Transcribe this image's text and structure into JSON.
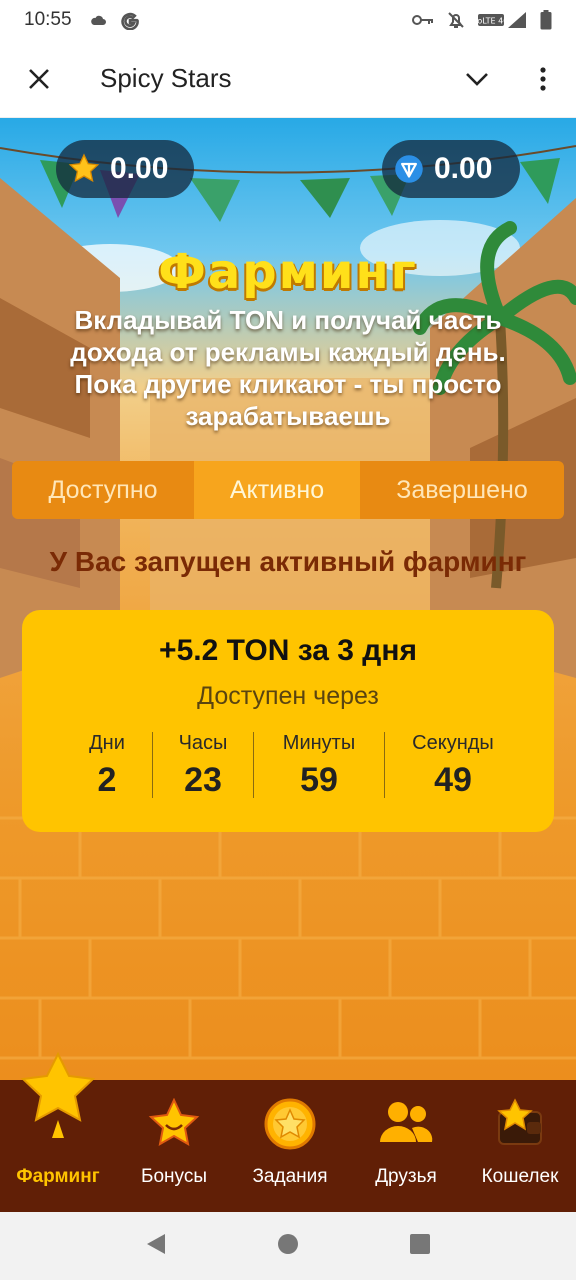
{
  "status_bar": {
    "time": "10:55",
    "network_label": "VoLTE 4G"
  },
  "app_bar": {
    "title": "Spicy Stars"
  },
  "balances": {
    "stars": "0.00",
    "ton": "0.00"
  },
  "hero": {
    "title": "Фарминг",
    "description": "Вкладывай TON и получай часть дохода от рекламы каждый день. Пока другие кликают - ты просто зарабатываешь"
  },
  "tabs": [
    {
      "label": "Доступно",
      "active": false
    },
    {
      "label": "Активно",
      "active": true
    },
    {
      "label": "Завершено",
      "active": false
    }
  ],
  "active_message": "У Вас запущен активный фарминг",
  "farm_card": {
    "reward": "+5.2 TON за 3 дня",
    "available_in": "Доступен через",
    "countdown": [
      {
        "label": "Дни",
        "value": "2"
      },
      {
        "label": "Часы",
        "value": "23"
      },
      {
        "label": "Минуты",
        "value": "59"
      },
      {
        "label": "Секунды",
        "value": "49"
      }
    ]
  },
  "bottom_nav": [
    {
      "label": "Фарминг",
      "icon": "star-icon",
      "active": true
    },
    {
      "label": "Бонусы",
      "icon": "smiling-star-icon",
      "active": false
    },
    {
      "label": "Задания",
      "icon": "star-coin-icon",
      "active": false
    },
    {
      "label": "Друзья",
      "icon": "people-icon",
      "active": false
    },
    {
      "label": "Кошелек",
      "icon": "wallet-icon",
      "active": false
    }
  ],
  "colors": {
    "accent": "#ffc400",
    "nav_background": "#611f06",
    "tab_background": "#e88a12",
    "tab_active": "#f7a51d",
    "message_text": "#7a2a05"
  }
}
